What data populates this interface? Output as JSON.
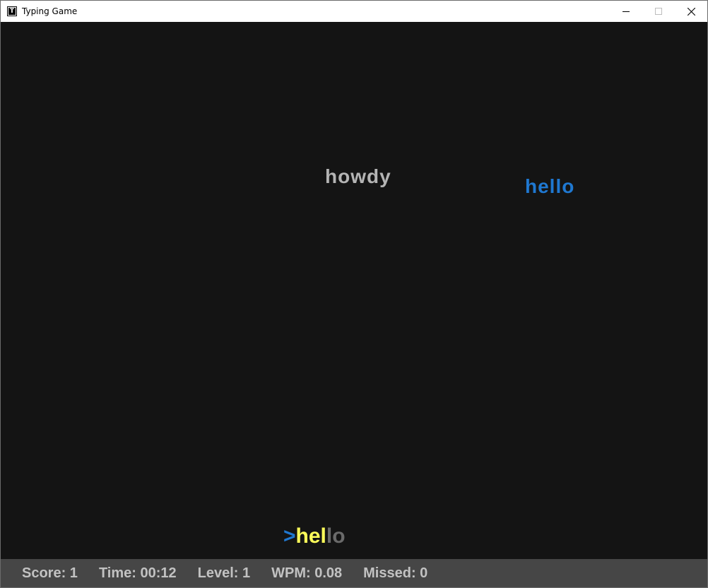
{
  "window": {
    "title": "Typing Game",
    "icon": "T",
    "icon_name": "app-t-icon",
    "controls": {
      "minimize_icon": "minimize-icon",
      "maximize_icon": "maximize-icon",
      "close_icon": "close-icon"
    }
  },
  "game": {
    "falling_words": [
      {
        "text": "howdy",
        "state": "idle",
        "color": "#b4b4b4"
      },
      {
        "text": "hello",
        "state": "targeted",
        "color": "#1f78d1"
      }
    ],
    "input": {
      "prompt": ">",
      "typed": "hel",
      "remaining": "lo",
      "prompt_color": "#1f78d1",
      "typed_color": "#ffff5a",
      "remaining_color": "#6a6a6a"
    }
  },
  "status": {
    "score": "Score: 1",
    "time": "Time: 00:12",
    "level": "Level: 1",
    "wpm": "WPM: 0.08",
    "missed": "Missed: 0"
  },
  "colors": {
    "background": "#141414",
    "statusbar": "#464646",
    "status_text": "#c2c2c2"
  }
}
